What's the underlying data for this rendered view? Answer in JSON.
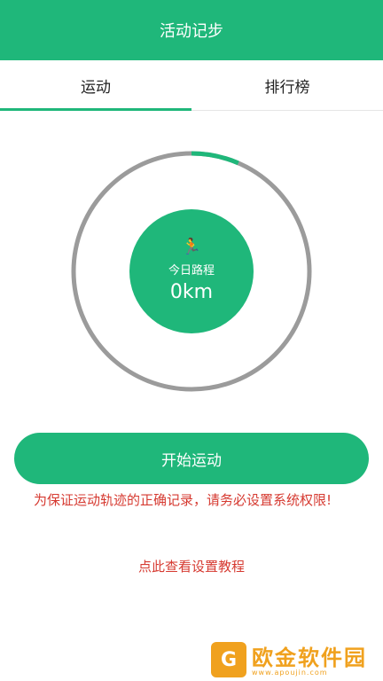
{
  "app": {
    "title": "活动记步"
  },
  "tabs": [
    {
      "label": "运动",
      "active": true
    },
    {
      "label": "排行榜",
      "active": false
    }
  ],
  "progress": {
    "fraction": 0.065,
    "track_color": "#9b9b9b",
    "fill_color": "#1fb77a"
  },
  "today": {
    "icon": "running-icon",
    "label": "今日路程",
    "value": "0km"
  },
  "start_button": {
    "label": "开始运动"
  },
  "warning": {
    "text": "为保证运动轨迹的正确记录，请务必设置系统权限!"
  },
  "tutorial_link": {
    "text": "点此查看设置教程"
  },
  "watermark": {
    "name": "欧金软件园",
    "url": "www.apoujin.com"
  },
  "colors": {
    "accent": "#1fb77a",
    "warning": "#d63a31",
    "watermark": "#f0a11e"
  }
}
